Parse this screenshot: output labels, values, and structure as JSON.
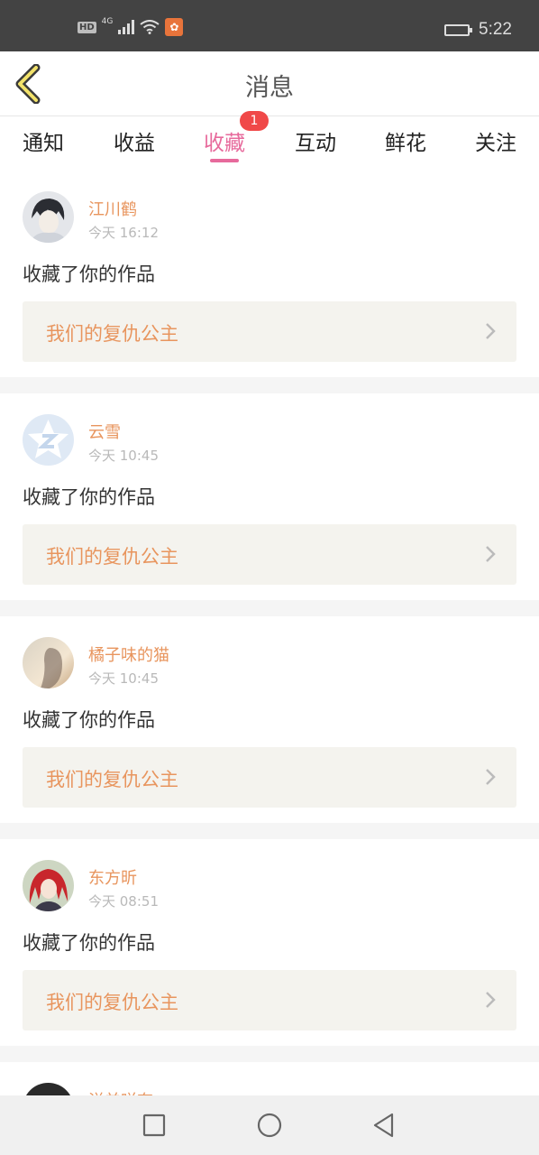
{
  "status_bar": {
    "hd": "HD",
    "network": "4G",
    "time": "5:22"
  },
  "header": {
    "title": "消息"
  },
  "tabs": [
    {
      "label": "通知"
    },
    {
      "label": "收益"
    },
    {
      "label": "收藏",
      "badge": "1",
      "active": true
    },
    {
      "label": "互动"
    },
    {
      "label": "鲜花"
    },
    {
      "label": "关注"
    }
  ],
  "messages": [
    {
      "username": "江川鹤",
      "time": "今天 16:12",
      "action": "收藏了你的作品",
      "work": "我们的复仇公主"
    },
    {
      "username": "云雪",
      "time": "今天 10:45",
      "action": "收藏了你的作品",
      "work": "我们的复仇公主"
    },
    {
      "username": "橘子味的猫",
      "time": "今天 10:45",
      "action": "收藏了你的作品",
      "work": "我们的复仇公主"
    },
    {
      "username": "东方昕",
      "time": "今天 08:51",
      "action": "收藏了你的作品",
      "work": "我们的复仇公主"
    }
  ],
  "partial_message": {
    "username": "洋羊咩奈"
  },
  "colors": {
    "accent": "#e76a9c",
    "name": "#e8955e",
    "badge": "#f04848"
  }
}
